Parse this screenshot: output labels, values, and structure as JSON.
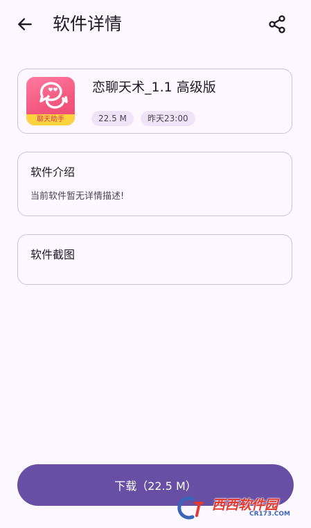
{
  "header": {
    "title": "软件详情",
    "back_icon": "arrow-left-icon",
    "share_icon": "share-icon"
  },
  "app": {
    "name": "恋聊天术_1.1 高级版",
    "icon_label": "聊天助手",
    "size": "22.5 M",
    "date": "昨天23:00"
  },
  "intro": {
    "heading": "软件介绍",
    "description": "当前软件暂无详情描述!"
  },
  "screenshots": {
    "heading": "软件截图"
  },
  "footer": {
    "download_label": "下载（22.5 M）"
  },
  "watermark": {
    "main": "西西软件园",
    "sub": "CR173.COM"
  },
  "colors": {
    "accent": "#6750a4",
    "background": "#fdf7ff",
    "chip": "#ede4f7",
    "icon_pink": "#f2557d",
    "icon_yellow": "#ffd23f"
  }
}
